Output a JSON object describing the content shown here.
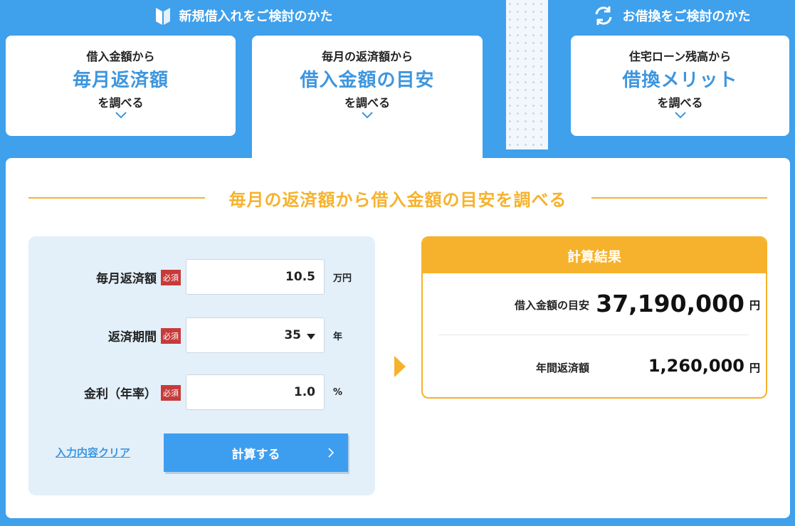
{
  "header": {
    "new_purchase": "新規借入れをご検討のかた",
    "refinance": "お借換をご検討のかた"
  },
  "tabs": [
    {
      "small": "借入金額から",
      "big": "毎月返済額",
      "after": "を調べる"
    },
    {
      "small": "毎月の返済額から",
      "big": "借入金額の目安",
      "after": "を調べる"
    },
    {
      "small": "住宅ローン残高から",
      "big": "借換メリット",
      "after": "を調べる"
    }
  ],
  "section_title": "毎月の返済額から借入金額の目安を調べる",
  "form": {
    "required_label": "必須",
    "monthly": {
      "label": "毎月返済額",
      "value": "10.5",
      "unit": "万円"
    },
    "period": {
      "label": "返済期間",
      "value": "35",
      "unit": "年"
    },
    "rate": {
      "label": "金利（年率）",
      "value": "1.0",
      "unit": "%"
    },
    "clear_label": "入力内容クリア",
    "calc_label": "計算する"
  },
  "result": {
    "title": "計算結果",
    "loan_label": "借入金額の目安",
    "loan_value": "37,190,000",
    "loan_unit": "円",
    "annual_label": "年間返済額",
    "annual_value": "1,260,000",
    "annual_unit": "円"
  },
  "colors": {
    "brand_blue": "#3fa0ec",
    "accent_orange": "#f6b22c",
    "required_red": "#c73a3a"
  },
  "icons": {
    "new_purchase": "beginner-leaf-icon",
    "refinance": "refresh-cycle-icon"
  }
}
